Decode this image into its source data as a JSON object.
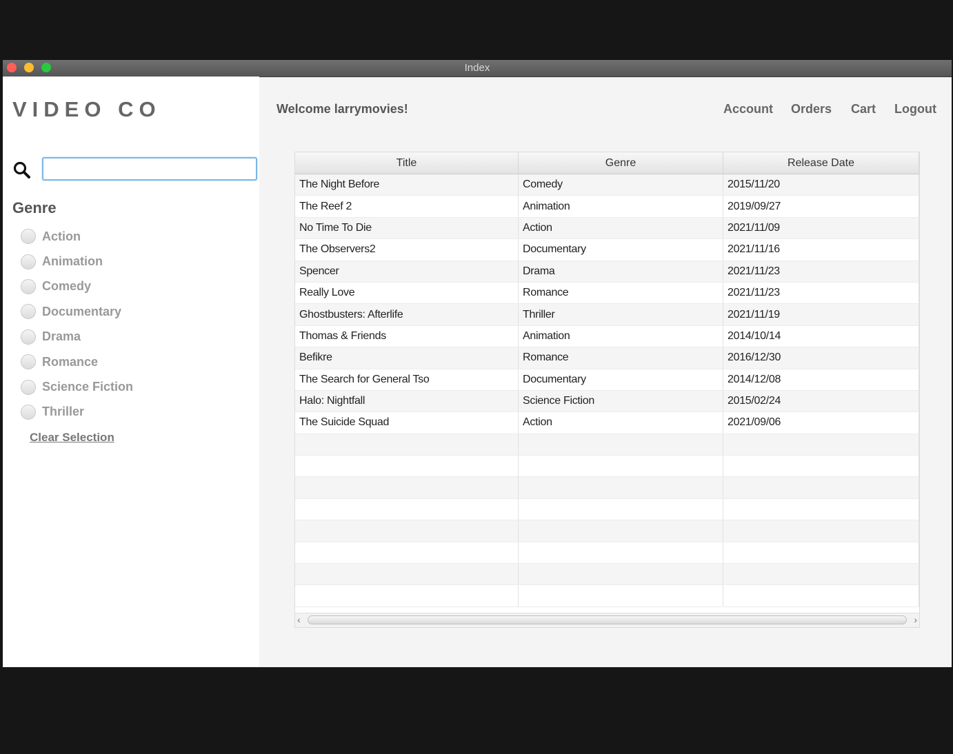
{
  "window": {
    "title": "Index"
  },
  "sidebar": {
    "logo": "VIDEO CO",
    "search": {
      "value": "",
      "placeholder": ""
    },
    "genre_title": "Genre",
    "genres": [
      {
        "label": "Action",
        "selected": false
      },
      {
        "label": "Animation",
        "selected": false
      },
      {
        "label": "Comedy",
        "selected": false
      },
      {
        "label": "Documentary",
        "selected": false
      },
      {
        "label": "Drama",
        "selected": false
      },
      {
        "label": "Romance",
        "selected": false
      },
      {
        "label": "Science Fiction",
        "selected": false
      },
      {
        "label": "Thriller",
        "selected": false
      }
    ],
    "clear_label": "Clear Selection"
  },
  "header": {
    "welcome": "Welcome larrymovies!",
    "nav": {
      "account": "Account",
      "orders": "Orders",
      "cart": "Cart",
      "logout": "Logout"
    }
  },
  "table": {
    "columns": [
      "Title",
      "Genre",
      "Release Date"
    ],
    "rows": [
      [
        "The Night Before",
        "Comedy",
        "2015/11/20"
      ],
      [
        "The Reef 2",
        "Animation",
        "2019/09/27"
      ],
      [
        "No Time To Die",
        "Action",
        "2021/11/09"
      ],
      [
        "The Observers2",
        "Documentary",
        "2021/11/16"
      ],
      [
        "Spencer",
        "Drama",
        "2021/11/23"
      ],
      [
        "Really Love",
        "Romance",
        "2021/11/23"
      ],
      [
        "Ghostbusters: Afterlife",
        "Thriller",
        "2021/11/19"
      ],
      [
        "Thomas & Friends",
        "Animation",
        "2014/10/14"
      ],
      [
        "Befikre",
        "Romance",
        "2016/12/30"
      ],
      [
        "The Search for General Tso",
        "Documentary",
        "2014/12/08"
      ],
      [
        "Halo: Nightfall",
        "Science Fiction",
        "2015/02/24"
      ],
      [
        "The Suicide Squad",
        "Action",
        "2021/09/06"
      ]
    ],
    "empty_rows": 8
  },
  "colors": {
    "accent_focus": "#7db6e8",
    "sidebar_bg": "#ffffff",
    "content_bg": "#f4f4f4"
  }
}
